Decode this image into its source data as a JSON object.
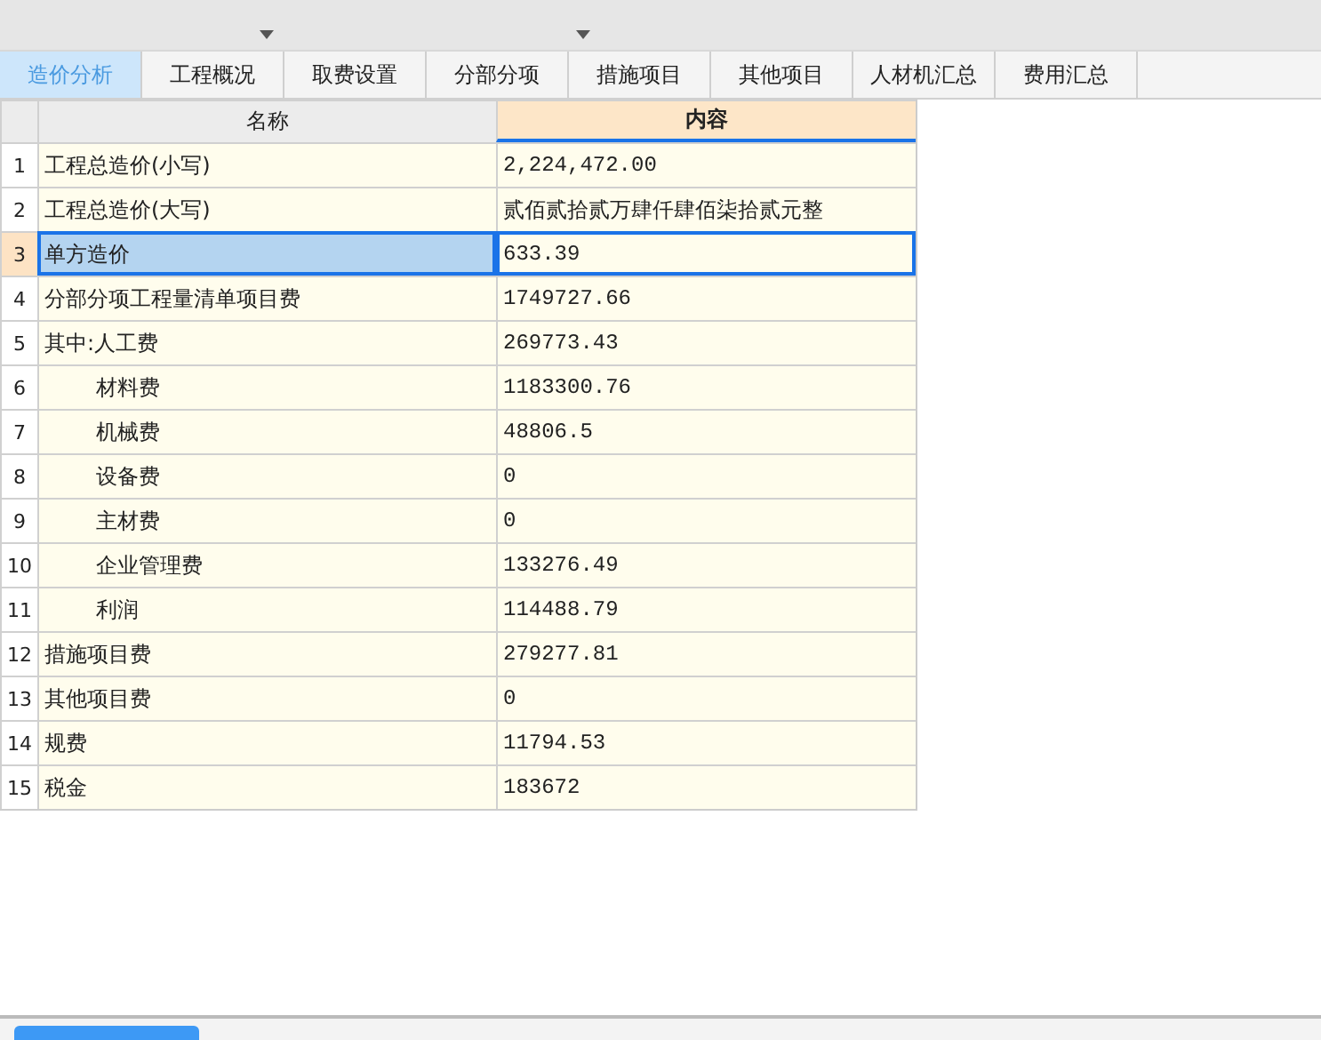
{
  "toolbar": {
    "dropdowns": [
      {
        "open": false
      },
      {
        "open": false
      }
    ]
  },
  "tabs": [
    {
      "label": "造价分析",
      "selected": true
    },
    {
      "label": "工程概况",
      "selected": false
    },
    {
      "label": "取费设置",
      "selected": false
    },
    {
      "label": "分部分项",
      "selected": false
    },
    {
      "label": "措施项目",
      "selected": false
    },
    {
      "label": "其他项目",
      "selected": false
    },
    {
      "label": "人材机汇总",
      "selected": false
    },
    {
      "label": "费用汇总",
      "selected": false
    }
  ],
  "table": {
    "columns": [
      "名称",
      "内容"
    ],
    "rows": [
      {
        "no": "1",
        "name": "工程总造价(小写)",
        "value": "2,224,472.00",
        "selected": false
      },
      {
        "no": "2",
        "name": "工程总造价(大写)",
        "value": "贰佰贰拾贰万肆仟肆佰柒拾贰元整",
        "selected": false
      },
      {
        "no": "3",
        "name": "单方造价",
        "value": "633.39",
        "selected": true
      },
      {
        "no": "4",
        "name": "分部分项工程量清单项目费",
        "value": "1749727.66",
        "selected": false
      },
      {
        "no": "5",
        "name": "其中:人工费",
        "value": "269773.43",
        "selected": false,
        "children": [
          {
            "no": "6",
            "name": "材料费",
            "value": "1183300.76",
            "selected": false
          },
          {
            "no": "7",
            "name": "机械费",
            "value": "48806.5",
            "selected": false
          },
          {
            "no": "8",
            "name": "设备费",
            "value": "0",
            "selected": false
          },
          {
            "no": "9",
            "name": "主材费",
            "value": "0",
            "selected": false
          },
          {
            "no": "10",
            "name": "企业管理费",
            "value": "133276.49",
            "selected": false
          },
          {
            "no": "11",
            "name": "利润",
            "value": "114488.79",
            "selected": false
          }
        ]
      },
      {
        "no": "12",
        "name": "措施项目费",
        "value": "279277.81",
        "selected": false
      },
      {
        "no": "13",
        "name": "其他项目费",
        "value": "0",
        "selected": false
      },
      {
        "no": "14",
        "name": "规费",
        "value": "11794.53",
        "selected": false
      },
      {
        "no": "15",
        "name": "税金",
        "value": "183672",
        "selected": false
      }
    ]
  }
}
